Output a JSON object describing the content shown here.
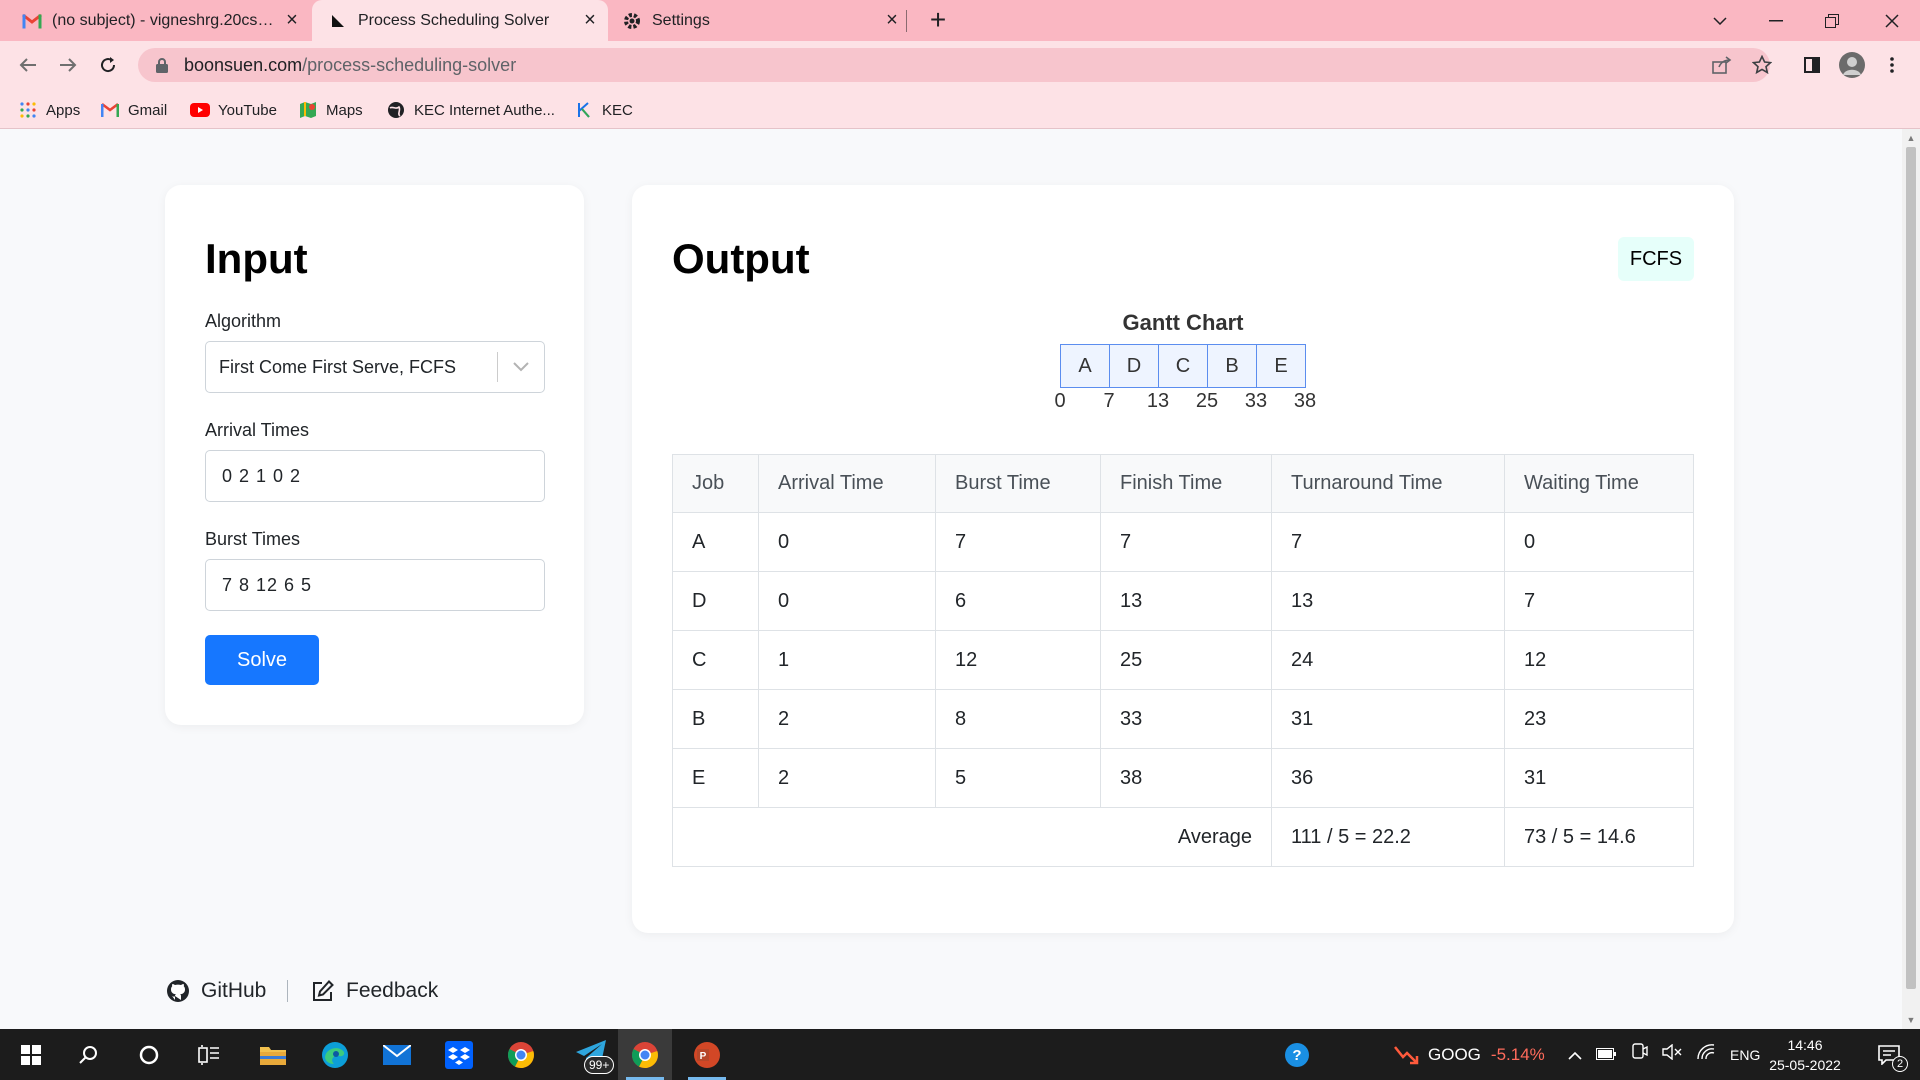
{
  "browser": {
    "tabs": [
      {
        "title": "(no subject) - vigneshrg.20cse@k",
        "icon": "gmail-icon"
      },
      {
        "title": "Process Scheduling Solver",
        "icon": "site-icon"
      },
      {
        "title": "Settings",
        "icon": "gear-icon"
      }
    ],
    "url_host": "boonsuen.com",
    "url_path": "/process-scheduling-solver",
    "bookmarks": [
      {
        "label": "Apps",
        "icon": "apps-grid-icon"
      },
      {
        "label": "Gmail",
        "icon": "gmail-icon"
      },
      {
        "label": "YouTube",
        "icon": "youtube-icon"
      },
      {
        "label": "Maps",
        "icon": "maps-icon"
      },
      {
        "label": "KEC Internet Authe...",
        "icon": "globe-icon"
      },
      {
        "label": "KEC",
        "icon": "kec-icon"
      }
    ]
  },
  "input": {
    "title": "Input",
    "algorithm_label": "Algorithm",
    "algorithm_value": "First Come First Serve, FCFS",
    "arrival_label": "Arrival Times",
    "arrival_value": "0 2 1 0 2",
    "burst_label": "Burst Times",
    "burst_value": "7 8 12 6 5",
    "solve_label": "Solve"
  },
  "output": {
    "title": "Output",
    "algorithm_badge": "FCFS",
    "gantt_title": "Gantt Chart",
    "gantt_jobs": [
      "A",
      "D",
      "C",
      "B",
      "E"
    ],
    "gantt_times": [
      "0",
      "7",
      "13",
      "25",
      "33",
      "38"
    ],
    "table": {
      "headers": [
        "Job",
        "Arrival Time",
        "Burst Time",
        "Finish Time",
        "Turnaround Time",
        "Waiting Time"
      ],
      "rows": [
        [
          "A",
          "0",
          "7",
          "7",
          "7",
          "0"
        ],
        [
          "D",
          "0",
          "6",
          "13",
          "13",
          "7"
        ],
        [
          "C",
          "1",
          "12",
          "25",
          "24",
          "12"
        ],
        [
          "B",
          "2",
          "8",
          "33",
          "31",
          "23"
        ],
        [
          "E",
          "2",
          "5",
          "38",
          "36",
          "31"
        ]
      ],
      "average_label": "Average",
      "average_turnaround": "111 / 5 = 22.2",
      "average_waiting": "73 / 5 = 14.6"
    }
  },
  "footer": {
    "github_label": "GitHub",
    "feedback_label": "Feedback"
  },
  "taskbar": {
    "notification_count": "99+",
    "stock_symbol": "GOOG",
    "stock_change": "-5.14%",
    "language": "ENG",
    "time": "14:46",
    "date": "25-05-2022",
    "action_center_count": "2"
  },
  "colors": {
    "tab_bar": "#fab7c2",
    "toolbar": "#fde2e6",
    "solve_button": "#1677ff",
    "badge_bg": "#e6fffa",
    "stock_down": "#ff6b5b"
  }
}
